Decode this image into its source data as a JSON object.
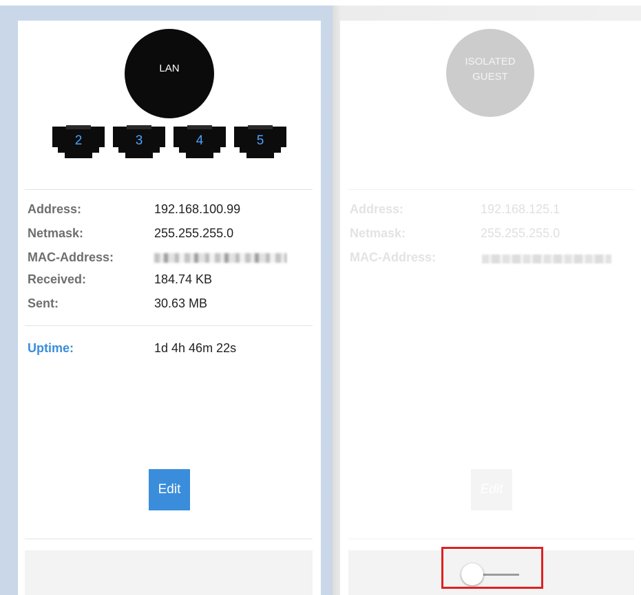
{
  "interfaces": [
    {
      "circle_label": "LAN",
      "ports": [
        "2",
        "3",
        "4",
        "5"
      ],
      "info": [
        {
          "label": "Address:",
          "value": "192.168.100.99"
        },
        {
          "label": "Netmask:",
          "value": "255.255.255.0"
        },
        {
          "label": "MAC-Address:",
          "value": ""
        },
        {
          "label": "Received:",
          "value": "184.74 KB"
        },
        {
          "label": "Sent:",
          "value": "30.63 MB"
        }
      ],
      "uptime": {
        "label": "Uptime:",
        "value": "1d 4h 46m 22s"
      },
      "edit_label": "Edit",
      "accent": "#3a8ddb",
      "enabled": true
    },
    {
      "circle_label": "ISOLATED\nGUEST",
      "info": [
        {
          "label": "Address:",
          "value": "192.168.125.1"
        },
        {
          "label": "Netmask:",
          "value": "255.255.255.0"
        },
        {
          "label": "MAC-Address:",
          "value": ""
        }
      ],
      "edit_label": "Edit",
      "enabled": false,
      "toggle_state": "off"
    }
  ],
  "colors": {
    "lan_frame": "#c9d7e9",
    "accent_blue": "#3a8ddb",
    "port_number": "#4aa3ff",
    "highlight": "#e02020"
  }
}
